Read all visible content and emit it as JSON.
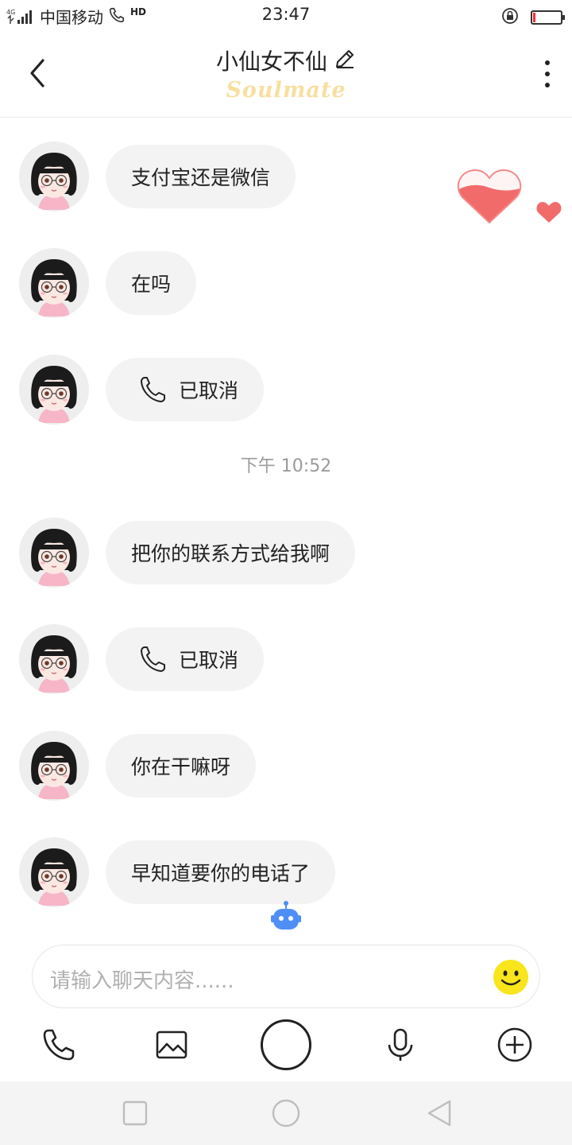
{
  "status_bar": {
    "network": "4G",
    "carrier": "中国移动",
    "hd": "HD",
    "time": "23:47"
  },
  "header": {
    "title": "小仙女不仙",
    "subtitle": "Soulmate"
  },
  "messages": [
    {
      "type": "text",
      "text": "支付宝还是微信"
    },
    {
      "type": "text",
      "text": "在吗"
    },
    {
      "type": "call",
      "text": "已取消"
    },
    {
      "type": "text",
      "text": "把你的联系方式给我啊"
    },
    {
      "type": "call",
      "text": "已取消"
    },
    {
      "type": "text",
      "text": "你在干嘛呀"
    },
    {
      "type": "text",
      "text": "早知道要你的电话了"
    }
  ],
  "timestamp": "下午 10:52",
  "input": {
    "placeholder": "请输入聊天内容......"
  },
  "icons": {
    "back": "back-arrow-icon",
    "title_edit": "pencil-icon",
    "more": "more-vertical-icon",
    "call": "phone-icon",
    "heart_meter": "heart-icon",
    "robot": "robot-icon",
    "emoji": "smiley-icon",
    "tools": [
      "phone-icon",
      "image-icon",
      "record-button",
      "microphone-icon",
      "plus-circle-icon"
    ],
    "nav": [
      "recents-square-icon",
      "home-circle-icon",
      "back-triangle-icon"
    ]
  },
  "colors": {
    "bubble": "#f3f3f3",
    "heart": "#f26b6b",
    "soulmate": "#f5c744",
    "robot": "#4f8ef7",
    "emoji": "#f8e51b"
  }
}
